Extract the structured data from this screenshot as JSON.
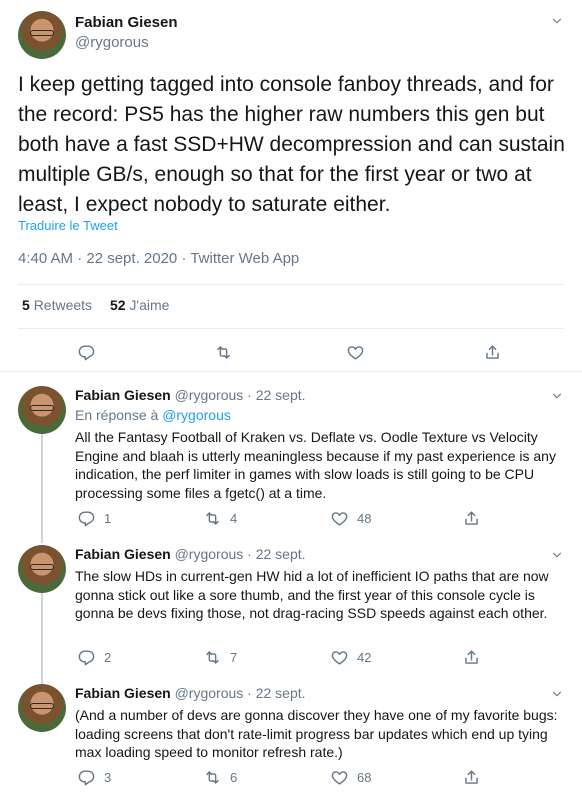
{
  "main_tweet": {
    "author_name": "Fabian Giesen",
    "author_handle": "@rygorous",
    "text": "I keep getting tagged into console fanboy threads, and for the record: PS5 has the higher raw numbers this gen but both have a fast SSD+HW decompression and can sustain multiple GB/s, enough so that for the first year or two at least, I expect nobody to saturate either.",
    "translate_label": "Traduire le Tweet",
    "timestamp": "4:40 AM · 22 sept. 2020 · Twitter Web App",
    "retweets_count": "5",
    "retweets_label": "Retweets",
    "likes_count": "52",
    "likes_label": "J'aime"
  },
  "replies": [
    {
      "author_name": "Fabian Giesen",
      "author_handle": "@rygorous",
      "date": "· 22 sept.",
      "reply_to_prefix": "En réponse à",
      "reply_to_handle": "@rygorous",
      "text": "All the Fantasy Football of Kraken vs. Deflate vs. Oodle Texture vs Velocity Engine and blaah is utterly meaningless because if my past experience is any indication, the perf limiter in games with slow loads is still going to be CPU processing some files a fgetc() at a time.",
      "reply_count": "1",
      "retweet_count": "4",
      "like_count": "48"
    },
    {
      "author_name": "Fabian Giesen",
      "author_handle": "@rygorous",
      "date": "· 22 sept.",
      "text": "The slow HDs in current-gen HW hid a lot of inefficient IO paths that are now gonna stick out like a sore thumb, and the first year of this console cycle is gonna be devs fixing those, not drag-racing SSD speeds against each other.",
      "reply_count": "2",
      "retweet_count": "7",
      "like_count": "42"
    },
    {
      "author_name": "Fabian Giesen",
      "author_handle": "@rygorous",
      "date": "· 22 sept.",
      "text": "(And a number of devs are gonna discover they have one of my favorite bugs: loading screens that don't rate-limit progress bar updates which end up tying max loading speed to monitor refresh rate.)",
      "reply_count": "3",
      "retweet_count": "6",
      "like_count": "68"
    }
  ],
  "icons": {
    "reply": "reply-icon",
    "retweet": "retweet-icon",
    "like": "like-icon",
    "share": "share-icon",
    "more": "chevron-down-icon"
  },
  "colors": {
    "accent": "#1da1f2",
    "secondary_text": "#657786",
    "border": "#e6ecf0"
  }
}
